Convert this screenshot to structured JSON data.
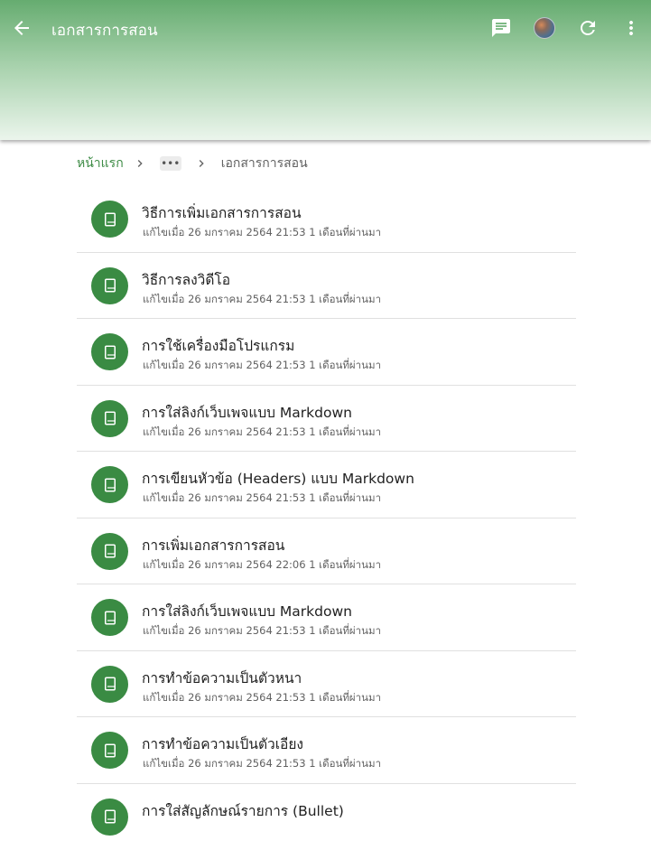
{
  "header": {
    "title": "เอกสารการสอน",
    "back_icon": "arrow-back-icon",
    "actions": [
      "comment-icon",
      "avatar",
      "refresh-icon",
      "more-vert-icon"
    ],
    "gradient_colors": [
      "#66ac70",
      "#ebf5ec"
    ]
  },
  "breadcrumb": {
    "home": "หน้าแรก",
    "more": "•••",
    "current": "เอกสารการสอน"
  },
  "accent_color": "#3a8b43",
  "items": [
    {
      "title": "วิธีการเพิ่มเอกสารการสอน",
      "meta": "แก้ไขเมื่อ 26 มกราคม 2564 21:53 1 เดือนที่ผ่านมา"
    },
    {
      "title": "วิธีการลงวิดีโอ",
      "meta": "แก้ไขเมื่อ 26 มกราคม 2564 21:53 1 เดือนที่ผ่านมา"
    },
    {
      "title": "การใช้เครื่องมือโปรแกรม",
      "meta": "แก้ไขเมื่อ 26 มกราคม 2564 21:53 1 เดือนที่ผ่านมา"
    },
    {
      "title": "การใส่ลิงก์เว็บเพจแบบ Markdown",
      "meta": "แก้ไขเมื่อ 26 มกราคม 2564 21:53 1 เดือนที่ผ่านมา"
    },
    {
      "title": "การเขียนหัวข้อ (Headers) แบบ Markdown",
      "meta": "แก้ไขเมื่อ 26 มกราคม 2564 21:53 1 เดือนที่ผ่านมา"
    },
    {
      "title": "การเพิ่มเอกสารการสอน",
      "meta": "แก้ไขเมื่อ 26 มกราคม 2564 22:06 1 เดือนที่ผ่านมา"
    },
    {
      "title": "การใส่ลิงก์เว็บเพจแบบ Markdown",
      "meta": "แก้ไขเมื่อ 26 มกราคม 2564 21:53 1 เดือนที่ผ่านมา"
    },
    {
      "title": "การทำข้อความเป็นตัวหนา",
      "meta": "แก้ไขเมื่อ 26 มกราคม 2564 21:53 1 เดือนที่ผ่านมา"
    },
    {
      "title": "การทำข้อความเป็นตัวเอียง",
      "meta": "แก้ไขเมื่อ 26 มกราคม 2564 21:53 1 เดือนที่ผ่านมา"
    },
    {
      "title": "การใส่สัญลักษณ์รายการ (Bullet)",
      "meta": ""
    }
  ]
}
